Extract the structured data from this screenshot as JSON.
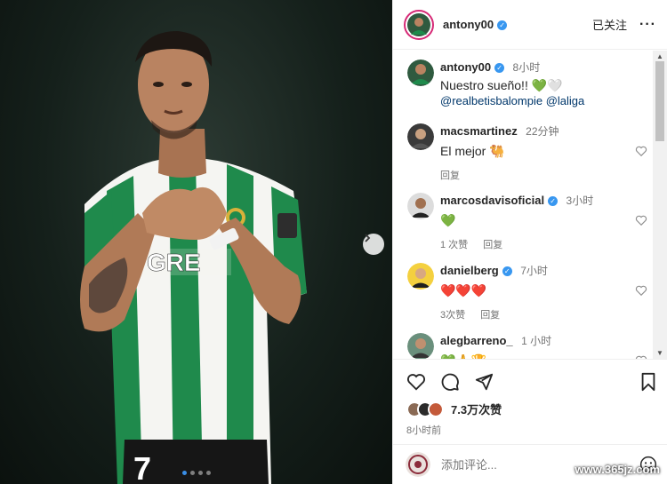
{
  "post": {
    "image_alt": "",
    "next_icon": "chevron-right-icon",
    "carousel": {
      "count": 4,
      "active": 1
    }
  },
  "header": {
    "username": "antony00",
    "follow_state": "已关注",
    "more_icon": "more-horizontal-icon"
  },
  "caption": {
    "username": "antony00",
    "time": "8小时",
    "text": "Nuestro sueño!! 💚🤍",
    "mentions": "@realbetisbalompie @laliga"
  },
  "comments": [
    {
      "username": "macsmartinez",
      "verified": false,
      "time": "22分钟",
      "text": "El mejor 🐫",
      "likes": "",
      "reply": "回复"
    },
    {
      "username": "marcosdavisoficial",
      "verified": true,
      "time": "3小时",
      "text": "💚",
      "likes": "1 次赞",
      "reply": "回复"
    },
    {
      "username": "danielberg",
      "verified": true,
      "time": "7小时",
      "text": "❤️❤️❤️",
      "likes": "3次赞",
      "reply": "回复"
    },
    {
      "username": "alegbarreno_",
      "verified": false,
      "time": "1 小时",
      "text": "💚🙏🏆",
      "likes": "",
      "reply": ""
    }
  ],
  "actions": {
    "like_icon": "heart-icon",
    "comment_icon": "comment-icon",
    "share_icon": "send-icon",
    "save_icon": "bookmark-icon",
    "likes": "7.3万次赞",
    "post_time": "8小时前"
  },
  "add_comment": {
    "placeholder": "添加评论...",
    "emoji_icon": "emoji-icon"
  },
  "watermark": "www.365jz.com",
  "colors": {
    "accent": "#3897f0",
    "betis_green": "#1f8a4c",
    "heart_red": "#ed4956"
  }
}
